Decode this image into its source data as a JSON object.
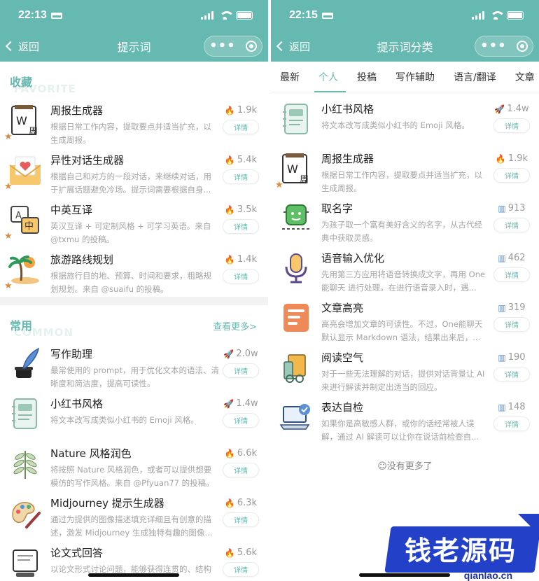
{
  "colors": {
    "accent": "#66b9b0",
    "hot": "#f2682c",
    "rocket": "#c0392b",
    "chart": "#5b8fd6",
    "star": "#e08a3c"
  },
  "left": {
    "status_time": "22:13",
    "back_label": "返回",
    "title": "提示词",
    "favorites": {
      "title": "收藏",
      "subtitle": "FAVORITE",
      "items": [
        {
          "name": "周报生成器",
          "desc": "根据日常工作内容，提取要点并适当扩充，以生成周报。",
          "stat": "1.9k",
          "stat_icon": "fire-icon",
          "button": "详情",
          "starred": true
        },
        {
          "name": "异性对话生成器",
          "desc": "根据自己和对方的一段对话，来继续对话，用于扩展话题避免冷场。提示词需要根据自身...",
          "stat": "5.4k",
          "stat_icon": "fire-icon",
          "button": "详情",
          "starred": true
        },
        {
          "name": "中英互译",
          "desc": "英汉互译 + 可定制风格 + 可学习英语。来自 @txmu 的投稿。",
          "stat": "3.5k",
          "stat_icon": "fire-icon",
          "button": "详情",
          "starred": true
        },
        {
          "name": "旅游路线规划",
          "desc": "根据旅行目的地、预算、时间和要求，粗略规划规划。来自 @suaifu 的投稿。",
          "stat": "1.4k",
          "stat_icon": "fire-icon",
          "button": "详情",
          "starred": true
        }
      ]
    },
    "common": {
      "title": "常用",
      "subtitle": "COMMON",
      "more": "查看更多>",
      "items": [
        {
          "name": "写作助理",
          "desc": "最常使用的 prompt，用于优化文本的语法、清晰度和简洁度，提高可读性。",
          "stat": "2.0w",
          "stat_icon": "rocket-icon",
          "button": "详情"
        },
        {
          "name": "小红书风格",
          "desc": "将文本改写成类似小红书的 Emoji 风格。",
          "stat": "1.4w",
          "stat_icon": "rocket-icon",
          "button": "详情"
        },
        {
          "name": "Nature 风格润色",
          "desc": "将按照 Nature 风格润色，或者可以提供想要模仿的写作风格。来自 @Pfyuan77 的投稿。",
          "stat": "6.6k",
          "stat_icon": "fire-icon",
          "button": "详情"
        },
        {
          "name": "Midjourney 提示生成器",
          "desc": "通过为提供的图像描述填充详细且有创意的描述，激发 Midjourney 生成独特有趣的图像...",
          "stat": "6.3k",
          "stat_icon": "fire-icon",
          "button": "详情"
        },
        {
          "name": "论文式回答",
          "desc": "以论文形式讨论问题，能够获得连贯的、结构",
          "stat": "5.6k",
          "stat_icon": "fire-icon",
          "button": "详情"
        }
      ]
    }
  },
  "right": {
    "status_time": "22:15",
    "back_label": "返回",
    "title": "提示词分类",
    "tabs": [
      "最新",
      "个人",
      "投稿",
      "写作辅助",
      "语言/翻译",
      "文章"
    ],
    "active_tab": "个人",
    "items": [
      {
        "name": "小红书风格",
        "desc": "将文本改写成类似小红书的 Emoji 风格。",
        "stat": "1.4w",
        "stat_icon": "rocket-icon",
        "button": "详情"
      },
      {
        "name": "周报生成器",
        "desc": "根据日常工作内容，提取要点并适当扩充，以生成周报。",
        "stat": "1.9k",
        "stat_icon": "fire-icon",
        "button": "详情",
        "starred": true
      },
      {
        "name": "取名字",
        "desc": "为孩子取一个富有美好含义的名字，从古代经典中获取灵感。",
        "stat": "913",
        "stat_icon": "chart-icon",
        "button": "详情"
      },
      {
        "name": "语音输入优化",
        "desc": "先用第三方应用将语音转换成文字，再用 One 能聊天 进行处理。在进行语音录入时，遇...",
        "stat": "462",
        "stat_icon": "chart-icon",
        "button": "详情"
      },
      {
        "name": "文章高亮",
        "desc": "高亮会增加文章的可读性。不过，One能聊天 默认显示 Markdown 语法，结果出来后，...",
        "stat": "319",
        "stat_icon": "chart-icon",
        "button": "详情"
      },
      {
        "name": "阅读空气",
        "desc": "对于一些无法理解的对话，提供对话背景让 AI 来进行解读并制定出适当的回应。",
        "stat": "190",
        "stat_icon": "chart-icon",
        "button": "详情"
      },
      {
        "name": "表达自检",
        "desc": "如果你是高敏感人群，或你的话经常被人误解，通过 AI 解读可以让你在说话前检查自...",
        "stat": "148",
        "stat_icon": "chart-icon",
        "button": "详情"
      }
    ],
    "no_more": "☺没有更多了"
  },
  "watermark": {
    "text": "钱老源码",
    "url": "qianlao.cn"
  }
}
